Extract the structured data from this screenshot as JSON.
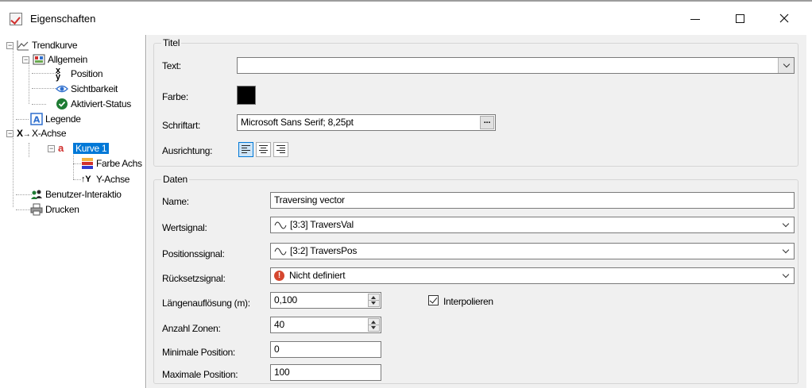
{
  "window": {
    "title": "Eigenschaften"
  },
  "tree": {
    "root": "Trendkurve",
    "allgemein": "Allgemein",
    "position": "Position",
    "sichtbarkeit": "Sichtbarkeit",
    "aktiviert": "Aktiviert-Status",
    "legende": "Legende",
    "xachse": "X-Achse",
    "kurve1": "Kurve 1",
    "farbe": "Farbe Achs",
    "yachse": "Y-Achse",
    "benutzer": "Benutzer-Interaktio",
    "drucken": "Drucken"
  },
  "titel": {
    "legend": "Titel",
    "text_label": "Text:",
    "text_value": "",
    "farbe_label": "Farbe:",
    "farbe_color": "#000000",
    "schrift_label": "Schriftart:",
    "schrift_value": "Microsoft Sans Serif; 8,25pt",
    "ellipsis": "...",
    "ausrichtung_label": "Ausrichtung:"
  },
  "daten": {
    "legend": "Daten",
    "name_label": "Name:",
    "name_value": "Traversing vector",
    "wert_label": "Wertsignal:",
    "wert_value": "[3:3] TraversVal",
    "pos_label": "Positionssignal:",
    "pos_value": "[3:2] TraversPos",
    "reset_label": "Rücksetzsignal:",
    "reset_value": "Nicht definiert",
    "laenge_label": "Längenauflösung (m):",
    "laenge_value": "0,100",
    "interp_label": "Interpolieren",
    "zonen_label": "Anzahl Zonen:",
    "zonen_value": "40",
    "minpos_label": "Minimale Position:",
    "minpos_value": "0",
    "maxpos_label": "Maximale Position:",
    "maxpos_value": "100"
  }
}
